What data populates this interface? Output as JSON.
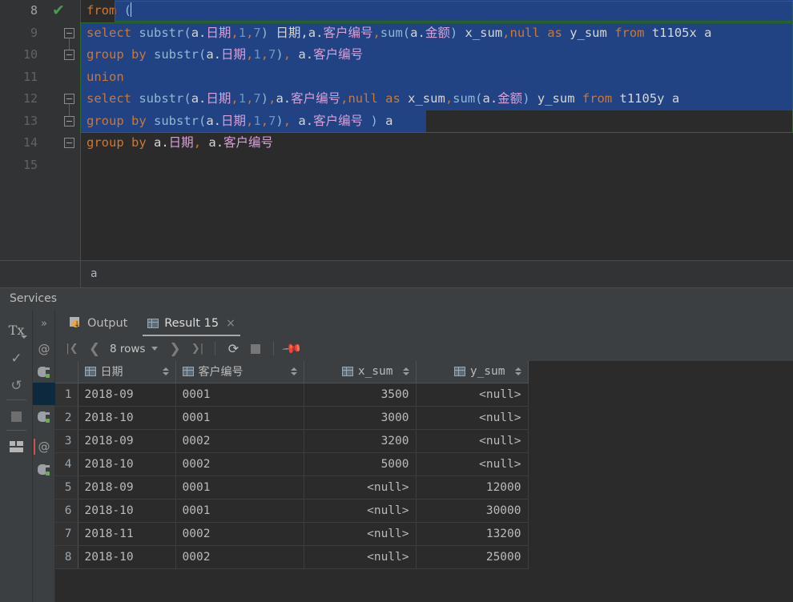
{
  "editor": {
    "lines": [
      {
        "number": "8",
        "marker": "check-mark",
        "fold": "none",
        "selected_prefix": false,
        "tokens": [
          {
            "t": "from ",
            "c": "kw"
          },
          {
            "t": "(",
            "c": "fn"
          }
        ]
      },
      {
        "number": "9",
        "marker": "",
        "fold": "expanded-start",
        "tokens": [
          {
            "t": "select",
            "c": "kw"
          },
          {
            "t": " ",
            "c": "plain"
          },
          {
            "t": "substr",
            "c": "fn"
          },
          {
            "t": "(",
            "c": "fn"
          },
          {
            "t": "a.",
            "c": "white"
          },
          {
            "t": "日期",
            "c": "col"
          },
          {
            "t": ",",
            "c": "kw"
          },
          {
            "t": "1",
            "c": "num"
          },
          {
            "t": ",",
            "c": "kw"
          },
          {
            "t": "7",
            "c": "num"
          },
          {
            "t": ")",
            "c": "fn"
          },
          {
            "t": " 日期,",
            "c": "white"
          },
          {
            "t": "a.",
            "c": "white"
          },
          {
            "t": "客户编号",
            "c": "col"
          },
          {
            "t": ",",
            "c": "kw"
          },
          {
            "t": "sum",
            "c": "fn"
          },
          {
            "t": "(",
            "c": "fn"
          },
          {
            "t": "a.",
            "c": "white"
          },
          {
            "t": "金额",
            "c": "col"
          },
          {
            "t": ")",
            "c": "fn"
          },
          {
            "t": " x_sum",
            "c": "white"
          },
          {
            "t": ",",
            "c": "kw"
          },
          {
            "t": "null",
            "c": "kw"
          },
          {
            "t": " ",
            "c": "plain"
          },
          {
            "t": "as",
            "c": "kw"
          },
          {
            "t": " y_sum ",
            "c": "white"
          },
          {
            "t": "from",
            "c": "kw"
          },
          {
            "t": " t1105x a",
            "c": "white"
          }
        ]
      },
      {
        "number": "10",
        "marker": "",
        "fold": "expanded-end",
        "tokens": [
          {
            "t": "group by",
            "c": "kw"
          },
          {
            "t": " ",
            "c": "plain"
          },
          {
            "t": "substr",
            "c": "fn"
          },
          {
            "t": "(",
            "c": "fn"
          },
          {
            "t": "a.",
            "c": "white"
          },
          {
            "t": "日期",
            "c": "col"
          },
          {
            "t": ",",
            "c": "kw"
          },
          {
            "t": "1",
            "c": "num"
          },
          {
            "t": ",",
            "c": "kw"
          },
          {
            "t": "7",
            "c": "num"
          },
          {
            "t": ")",
            "c": "fn"
          },
          {
            "t": ", ",
            "c": "kw"
          },
          {
            "t": "a.",
            "c": "white"
          },
          {
            "t": "客户编号",
            "c": "col"
          }
        ]
      },
      {
        "number": "11",
        "marker": "",
        "fold": "none",
        "tokens": [
          {
            "t": "union",
            "c": "kw"
          }
        ]
      },
      {
        "number": "12",
        "marker": "",
        "fold": "expanded-start",
        "tokens": [
          {
            "t": "select",
            "c": "kw"
          },
          {
            "t": " ",
            "c": "plain"
          },
          {
            "t": "substr",
            "c": "fn"
          },
          {
            "t": "(",
            "c": "fn"
          },
          {
            "t": "a.",
            "c": "white"
          },
          {
            "t": "日期",
            "c": "col"
          },
          {
            "t": ",",
            "c": "kw"
          },
          {
            "t": "1",
            "c": "num"
          },
          {
            "t": ",",
            "c": "kw"
          },
          {
            "t": "7",
            "c": "num"
          },
          {
            "t": ")",
            "c": "fn"
          },
          {
            "t": ",",
            "c": "kw"
          },
          {
            "t": "a.",
            "c": "white"
          },
          {
            "t": "客户编号",
            "c": "col"
          },
          {
            "t": ",",
            "c": "kw"
          },
          {
            "t": "null",
            "c": "kw"
          },
          {
            "t": " ",
            "c": "plain"
          },
          {
            "t": "as",
            "c": "kw"
          },
          {
            "t": " x_sum",
            "c": "white"
          },
          {
            "t": ",",
            "c": "kw"
          },
          {
            "t": "sum",
            "c": "fn"
          },
          {
            "t": "(",
            "c": "fn"
          },
          {
            "t": "a.",
            "c": "white"
          },
          {
            "t": "金额",
            "c": "col"
          },
          {
            "t": ")",
            "c": "fn"
          },
          {
            "t": " y_sum ",
            "c": "white"
          },
          {
            "t": "from",
            "c": "kw"
          },
          {
            "t": " t1105y a",
            "c": "white"
          }
        ]
      },
      {
        "number": "13",
        "marker": "",
        "fold": "expanded-end",
        "tokens": [
          {
            "t": "group by",
            "c": "kw"
          },
          {
            "t": " ",
            "c": "plain"
          },
          {
            "t": "substr",
            "c": "fn"
          },
          {
            "t": "(",
            "c": "fn"
          },
          {
            "t": "a.",
            "c": "white"
          },
          {
            "t": "日期",
            "c": "col"
          },
          {
            "t": ",",
            "c": "kw"
          },
          {
            "t": "1",
            "c": "num"
          },
          {
            "t": ",",
            "c": "kw"
          },
          {
            "t": "7",
            "c": "num"
          },
          {
            "t": ")",
            "c": "fn"
          },
          {
            "t": ", ",
            "c": "kw"
          },
          {
            "t": "a.",
            "c": "white"
          },
          {
            "t": "客户编号",
            "c": "col"
          },
          {
            "t": " ",
            "c": "plain"
          },
          {
            "t": ")",
            "c": "fn"
          }
        ],
        "trailing": " a"
      },
      {
        "number": "14",
        "marker": "",
        "fold": "single",
        "tokens": [
          {
            "t": "group by",
            "c": "kw"
          },
          {
            "t": " ",
            "c": "plain"
          },
          {
            "t": "a.",
            "c": "white"
          },
          {
            "t": "日期",
            "c": "col"
          },
          {
            "t": ", ",
            "c": "kw"
          },
          {
            "t": "a.",
            "c": "white"
          },
          {
            "t": "客户编号",
            "c": "col"
          }
        ]
      },
      {
        "number": "15",
        "marker": "",
        "fold": "none",
        "tokens": []
      }
    ],
    "status_text": "a",
    "selection_color": "#214283",
    "selection_border": "#2d6b2d"
  },
  "services": {
    "title": "Services"
  },
  "left_toolbar": {
    "tx_label": "Tx",
    "items": [
      {
        "name": "tx-button",
        "label": "Tx"
      },
      {
        "name": "commit-button",
        "label": "✓"
      },
      {
        "name": "rollback-button",
        "label": "↺"
      },
      {
        "name": "stop-button",
        "label": ""
      },
      {
        "name": "layout-button",
        "label": ""
      }
    ]
  },
  "db_rail": {
    "expand_label": "»",
    "items": [
      {
        "name": "at-icon-1",
        "glyph": "@"
      },
      {
        "name": "connection-icon-1",
        "glyph": ""
      },
      {
        "name": "connection-selected",
        "glyph": ""
      },
      {
        "name": "connection-icon-2",
        "glyph": ""
      },
      {
        "name": "at-icon-2",
        "glyph": "@"
      },
      {
        "name": "connection-icon-3",
        "glyph": ""
      }
    ]
  },
  "tabs": [
    {
      "label": "Output",
      "icon": "output-icon",
      "active": false,
      "closable": false
    },
    {
      "label": "Result 15",
      "icon": "result-grid-icon",
      "active": true,
      "closable": true,
      "close_label": "×"
    }
  ],
  "result_toolbar": {
    "first_page": "|◀",
    "prev_page": "‹",
    "rows_label": "8 rows",
    "next_page": "›",
    "last_page": "▶|",
    "refresh": "⟳",
    "stop": "",
    "pin": "📌"
  },
  "result_grid": {
    "columns": [
      {
        "label": "日期",
        "align": "left",
        "icon": "column-grid-icon"
      },
      {
        "label": "客户编号",
        "align": "left",
        "icon": "column-grid-icon"
      },
      {
        "label": "x_sum",
        "align": "right",
        "icon": "column-grid-icon"
      },
      {
        "label": "y_sum",
        "align": "right",
        "icon": "column-grid-icon"
      }
    ],
    "rows": [
      {
        "n": "1",
        "date": "2018-09",
        "cust": "0001",
        "x_sum": "3500",
        "y_sum": "<null>",
        "x_null": false,
        "y_null": true
      },
      {
        "n": "2",
        "date": "2018-10",
        "cust": "0001",
        "x_sum": "3000",
        "y_sum": "<null>",
        "x_null": false,
        "y_null": true
      },
      {
        "n": "3",
        "date": "2018-09",
        "cust": "0002",
        "x_sum": "3200",
        "y_sum": "<null>",
        "x_null": false,
        "y_null": true
      },
      {
        "n": "4",
        "date": "2018-10",
        "cust": "0002",
        "x_sum": "5000",
        "y_sum": "<null>",
        "x_null": false,
        "y_null": true
      },
      {
        "n": "5",
        "date": "2018-09",
        "cust": "0001",
        "x_sum": "<null>",
        "y_sum": "12000",
        "x_null": true,
        "y_null": false
      },
      {
        "n": "6",
        "date": "2018-10",
        "cust": "0001",
        "x_sum": "<null>",
        "y_sum": "30000",
        "x_null": true,
        "y_null": false
      },
      {
        "n": "7",
        "date": "2018-11",
        "cust": "0002",
        "x_sum": "<null>",
        "y_sum": "13200",
        "x_null": true,
        "y_null": false
      },
      {
        "n": "8",
        "date": "2018-10",
        "cust": "0002",
        "x_sum": "<null>",
        "y_sum": "25000",
        "x_null": true,
        "y_null": false
      }
    ]
  },
  "colors": {
    "editor_bg": "#2b2b2b",
    "panel_bg": "#3c3f41",
    "gutter_bg": "#313335",
    "selection": "#214283",
    "keyword": "#cc7832",
    "function": "#8fb9d4",
    "column": "#d9a0d9",
    "number": "#6897bb",
    "text": "#a9b7c6",
    "green_check": "#499c54"
  }
}
